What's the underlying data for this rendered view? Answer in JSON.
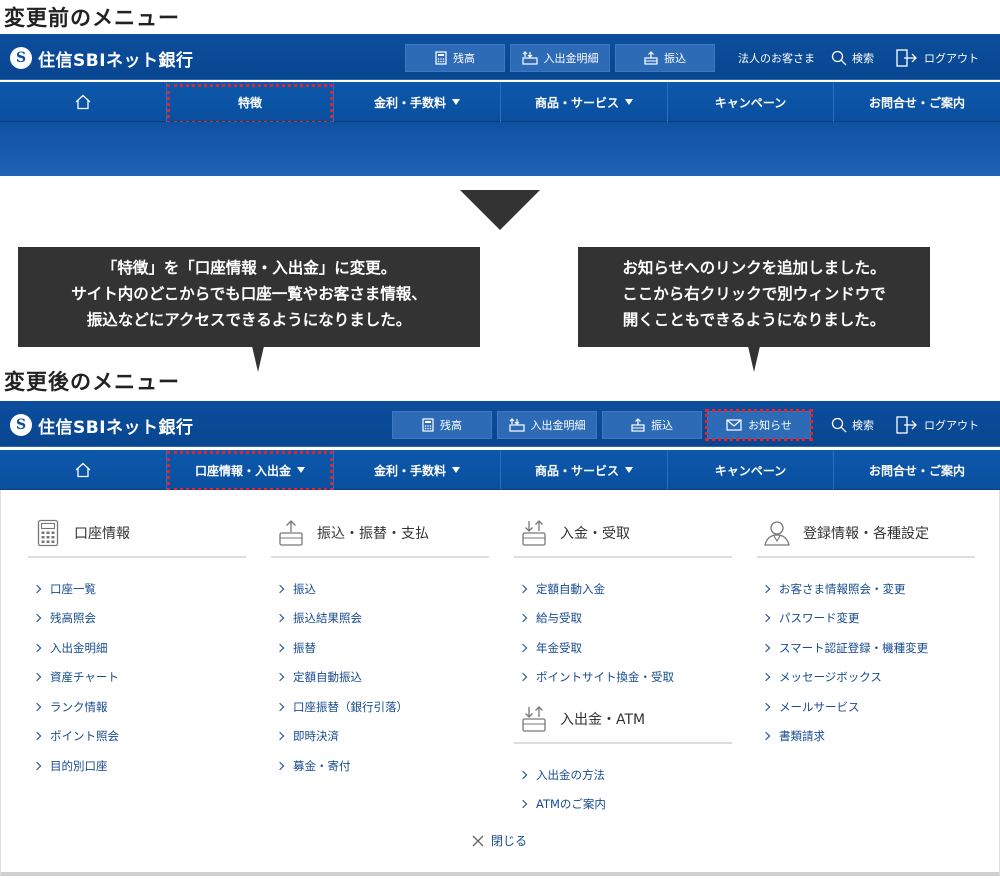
{
  "before": {
    "title": "変更前のメニュー",
    "logo_text": "住信SBIネット銀行",
    "toolbar": [
      {
        "label": "残高",
        "icon": "calculator-icon"
      },
      {
        "label": "入出金明細",
        "icon": "statement-icon"
      },
      {
        "label": "振込",
        "icon": "transfer-icon"
      }
    ],
    "corporate_link": "法人のお客さま",
    "search_label": "検索",
    "logout_label": "ログアウト",
    "nav": [
      "特徴",
      "金利・手数料",
      "商品・サービス",
      "キャンペーン",
      "お問合せ・ご案内"
    ]
  },
  "balloons": {
    "left": {
      "line1": "「特徴」を「口座情報・入出金」に変更。",
      "line2": "サイト内のどこからでも口座一覧やお客さま情報、",
      "line3": "振込などにアクセスできるようになりました。"
    },
    "right": {
      "line1": "お知らせへのリンクを追加しました。",
      "line2": "ここから右クリックで別ウィンドウで",
      "line3": "開くこともできるようになりました。"
    }
  },
  "after": {
    "title": "変更後のメニュー",
    "logo_text": "住信SBIネット銀行",
    "toolbar": [
      {
        "label": "残高",
        "icon": "calculator-icon"
      },
      {
        "label": "入出金明細",
        "icon": "statement-icon"
      },
      {
        "label": "振込",
        "icon": "transfer-icon"
      },
      {
        "label": "お知らせ",
        "icon": "mail-icon"
      }
    ],
    "search_label": "検索",
    "logout_label": "ログアウト",
    "nav": [
      "口座情報・入出金",
      "金利・手数料",
      "商品・サービス",
      "キャンペーン",
      "お問合せ・ご案内"
    ]
  },
  "mega_menu": {
    "columns": [
      {
        "heading": "口座情報",
        "icon": "calculator-icon",
        "items": [
          "口座一覧",
          "残高照会",
          "入出金明細",
          "資産チャート",
          "ランク情報",
          "ポイント照会",
          "目的別口座"
        ]
      },
      {
        "heading": "振込・振替・支払",
        "icon": "transfer-icon",
        "items": [
          "振込",
          "振込結果照会",
          "振替",
          "定額自動振込",
          "口座振替（銀行引落）",
          "即時決済",
          "募金・寄付"
        ]
      },
      {
        "heading": "入金・受取",
        "icon": "deposit-icon",
        "items": [
          "定額自動入金",
          "給与受取",
          "年金受取",
          "ポイントサイト換金・受取"
        ],
        "sub_heading": "入出金・ATM",
        "sub_items": [
          "入出金の方法",
          "ATMのご案内"
        ]
      },
      {
        "heading": "登録情報・各種設定",
        "icon": "user-icon",
        "items": [
          "お客さま情報照会・変更",
          "パスワード変更",
          "スマート認証登録・機種変更",
          "メッセージボックス",
          "メールサービス",
          "書類請求"
        ]
      }
    ],
    "close_label": "閉じる"
  }
}
